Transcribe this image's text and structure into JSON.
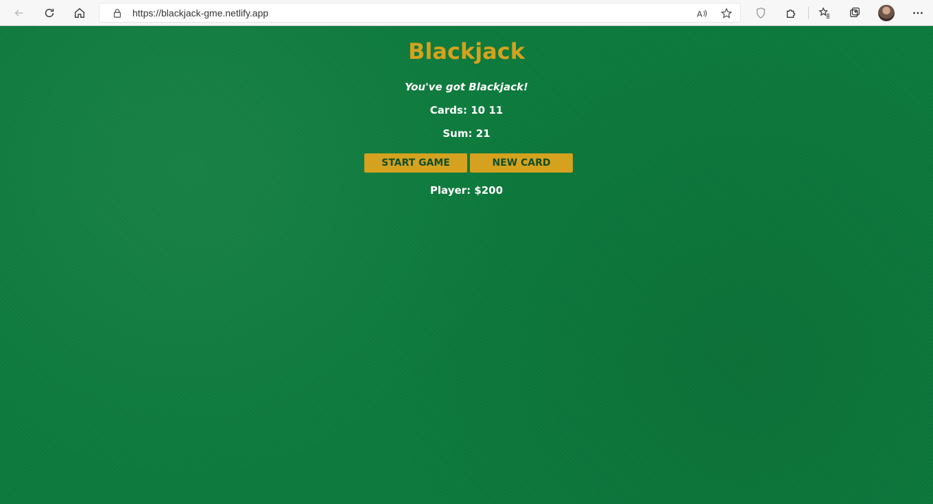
{
  "browser": {
    "url": "https://blackjack-gme.netlify.app",
    "icons": [
      "back-icon",
      "refresh-icon",
      "home-icon",
      "lock-icon",
      "read-aloud-icon",
      "add-favorite-icon",
      "shield-icon",
      "extensions-icon",
      "favorites-icon",
      "collections-icon",
      "profile-avatar",
      "more-icon"
    ]
  },
  "game": {
    "title": "Blackjack",
    "message": "You've got Blackjack!",
    "cards_label": "Cards:",
    "cards_value": "10 11",
    "sum_label": "Sum:",
    "sum_value": "21",
    "start_button": "START GAME",
    "new_card_button": "NEW CARD",
    "player_label": "Player:",
    "player_value": "$200"
  },
  "colors": {
    "felt": "#0b7a3b",
    "accent": "#d4a21e",
    "button_text": "#0f4d25",
    "text": "#ffffff"
  }
}
